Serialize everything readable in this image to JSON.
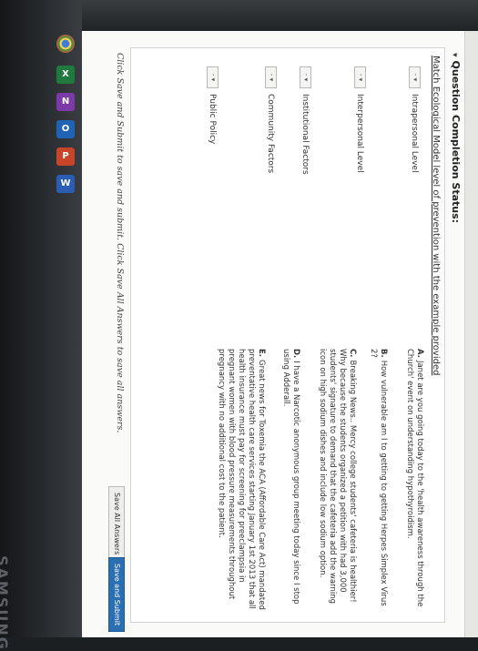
{
  "page_title": "Question Completion Status:",
  "instruction": "Match Ecological Model level of prevention with the example provided",
  "left_items": [
    {
      "label": "Intrapersonal Level"
    },
    {
      "label": "Interpersonal Level"
    },
    {
      "label": "Institutional Factors"
    },
    {
      "label": "Community Factors"
    },
    {
      "label": "Public Policy"
    }
  ],
  "answers": [
    {
      "letter": "A.",
      "text": "Janet are you going today to the 'health awareness through the Church' event on understanding hypothyroidism."
    },
    {
      "letter": "B.",
      "text": "How vulnerable am I to getting to getting Herpes Simplex Virus 2?"
    },
    {
      "letter": "C.",
      "text": "Breaking News.. Mercy college students' cafeteria is healthier! Why because the students organized a petition with had 3,000 students' signature to demand that the cafeteria add the warning icon on high sodium dishes and include low sodium option."
    },
    {
      "letter": "D.",
      "text": "I have a Narcotic anonymous group meeting today since I stop using Adderall."
    },
    {
      "letter": "E.",
      "text": "Great news for Toxemia the ACA (Affordable Care Act) mandated preventative health care services starting January 1st 2013 that all health insurance must pay for screening for preeclampsia in pregnant women with blood pressure measurements throughout pregnancy with no additional cost to the patient."
    }
  ],
  "footer_note": "Click Save and Submit to save and submit. Click Save All Answers to save all answers.",
  "buttons": {
    "save_all": "Save All Answers",
    "save_submit": "Save and Submit"
  },
  "brand": "SAMSUNG",
  "taskbar_icons": [
    {
      "name": "chrome-icon",
      "glyph": "",
      "color": "#2f8f3a"
    },
    {
      "name": "excel-icon",
      "glyph": "X",
      "color": "#1f7a3d"
    },
    {
      "name": "onenote-icon",
      "glyph": "N",
      "color": "#7b3aa8"
    },
    {
      "name": "outlook-icon",
      "glyph": "O",
      "color": "#1f63b5"
    },
    {
      "name": "powerpoint-icon",
      "glyph": "P",
      "color": "#c8452a"
    },
    {
      "name": "word-icon",
      "glyph": "W",
      "color": "#2b5db5"
    }
  ]
}
